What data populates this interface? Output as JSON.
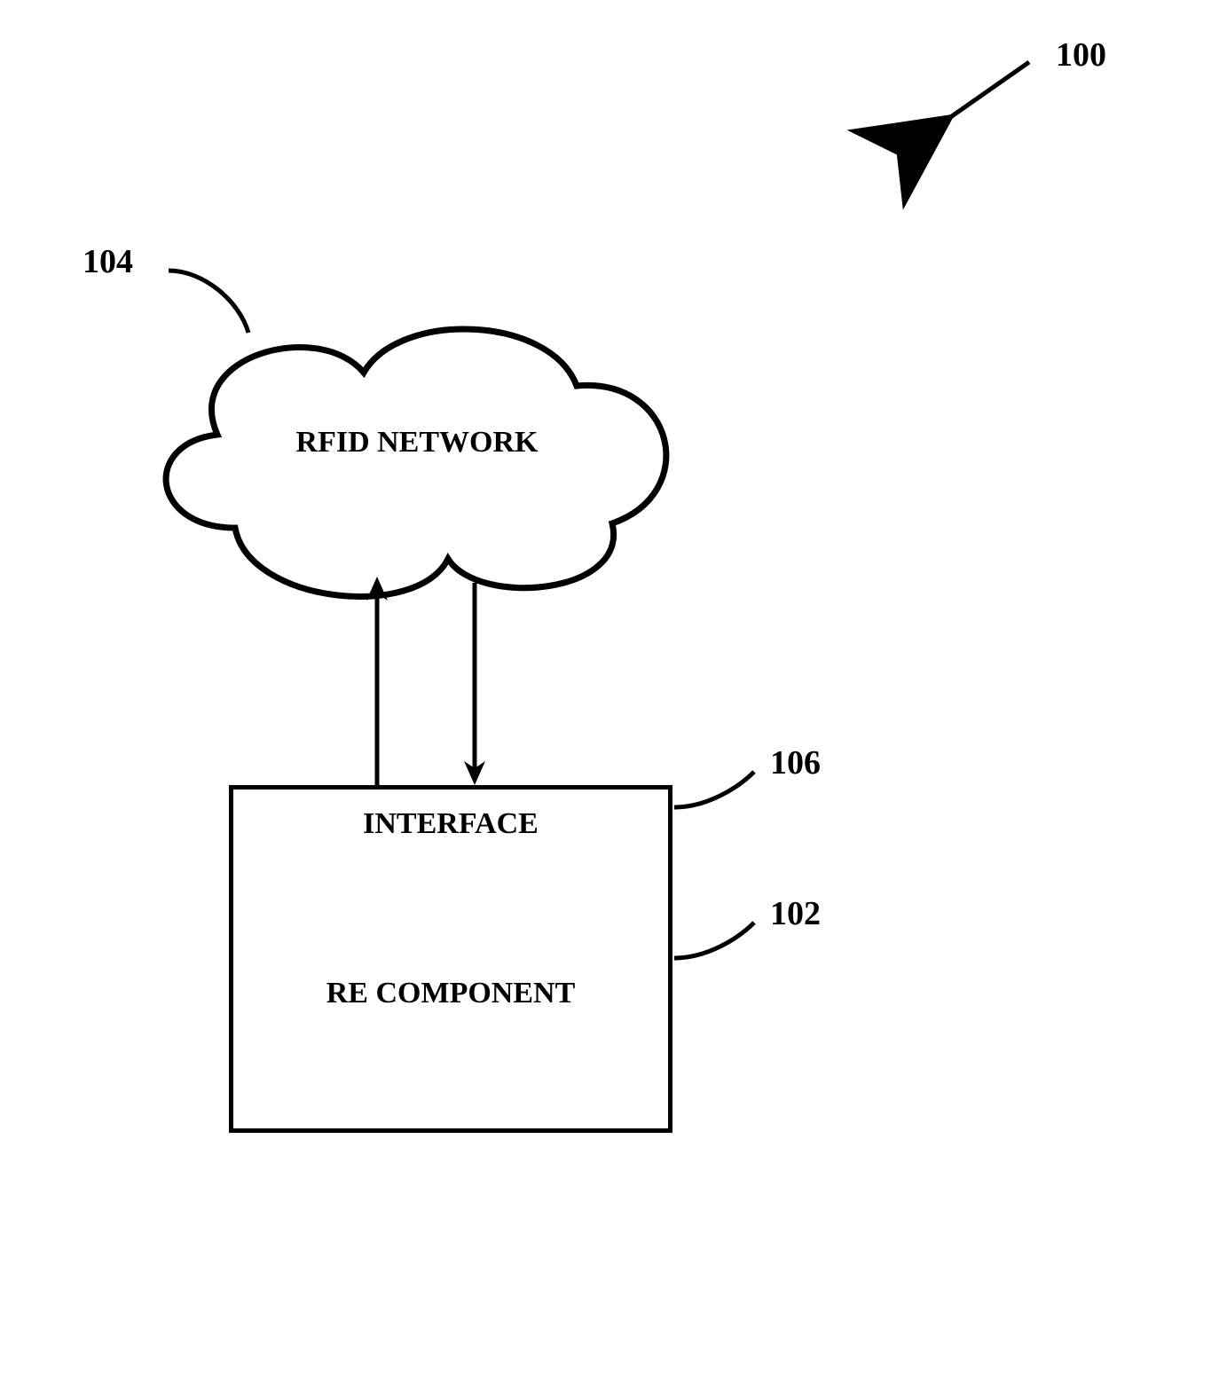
{
  "figure_ref": "100",
  "cloud": {
    "label": "RFID NETWORK",
    "ref": "104"
  },
  "interface": {
    "label": "INTERFACE",
    "ref": "106"
  },
  "re_component": {
    "label": "RE COMPONENT",
    "ref": "102"
  }
}
